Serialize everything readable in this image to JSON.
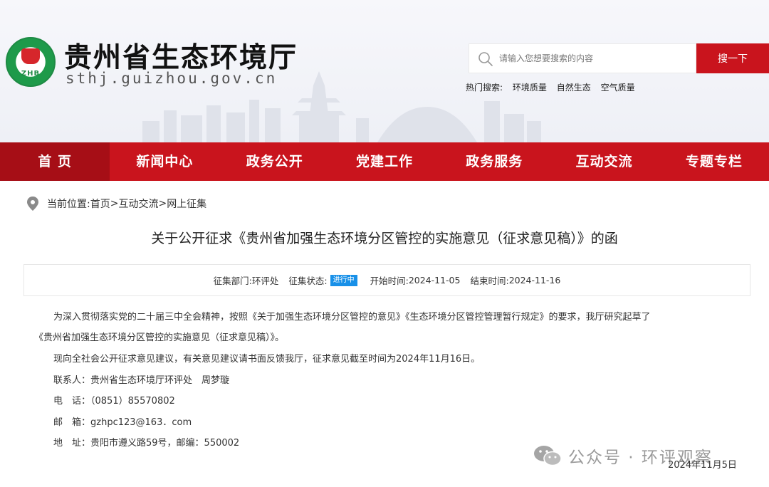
{
  "header": {
    "emblem_text": "ZHB",
    "site_title": "贵州省生态环境厅",
    "site_domain": "sthj.guizhou.gov.cn",
    "search": {
      "placeholder": "请输入您想要搜索的内容",
      "button_label": "搜一下"
    },
    "hot_search": {
      "label": "热门搜索:",
      "items": [
        "环境质量",
        "自然生态",
        "空气质量"
      ]
    }
  },
  "nav": {
    "items": [
      "首 页",
      "新闻中心",
      "政务公开",
      "党建工作",
      "政务服务",
      "互动交流",
      "专题专栏"
    ]
  },
  "breadcrumb": {
    "label": "当前位置:",
    "home": "首页",
    "sep1": ">",
    "section": "互动交流",
    "sep2": ">",
    "page": "网上征集"
  },
  "article": {
    "title": "关于公开征求《贵州省加强生态环境分区管控的实施意见（征求意见稿）》的函",
    "meta": {
      "dept_label": "征集部门:",
      "dept_value": "环评处",
      "status_label": "征集状态:",
      "status_value": "进行中",
      "start_label": "开始时间:",
      "start_value": "2024-11-05",
      "end_label": "结束时间:",
      "end_value": "2024-11-16"
    },
    "paragraphs": [
      "为深入贯彻落实党的二十届三中全会精神，按照《关于加强生态环境分区管控的意见》《生态环境分区管控管理暂行规定》的要求，我厅研究起草了",
      "《贵州省加强生态环境分区管控的实施意见（征求意见稿）》。",
      "现向全社会公开征求意见建议，有关意见建议请书面反馈我厅，征求意见截至时间为2024年11月16日。",
      "联系人：贵州省生态环境厅环评处　周梦璇",
      "电　话：（0851）85570802",
      "邮　箱：gzhpc123@163．com",
      "地　址：贵阳市遵义路59号，邮编：550002"
    ],
    "date": "2024年11月5日"
  },
  "watermark": {
    "text": "公众号 · 环评观察"
  },
  "colors": {
    "brand_red": "#c9141d",
    "nav_active": "#a60e16",
    "status_blue": "#1890e8"
  }
}
